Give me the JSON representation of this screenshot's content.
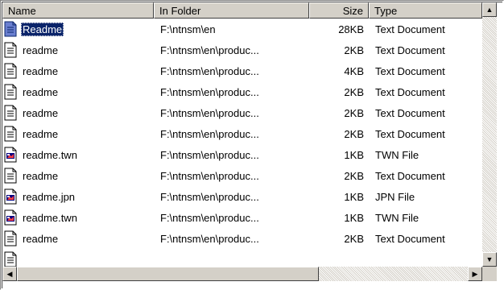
{
  "columns": {
    "name": "Name",
    "folder": "In Folder",
    "size": "Size",
    "type": "Type"
  },
  "rows": [
    {
      "name": "Readme",
      "folder": "F:\\ntnsm\\en",
      "size": "28KB",
      "type": "Text Document",
      "icon": "text-document-icon",
      "selected": true
    },
    {
      "name": "readme",
      "folder": "F:\\ntnsm\\en\\produc...",
      "size": "2KB",
      "type": "Text Document",
      "icon": "text-document-icon"
    },
    {
      "name": "readme",
      "folder": "F:\\ntnsm\\en\\produc...",
      "size": "4KB",
      "type": "Text Document",
      "icon": "text-document-icon"
    },
    {
      "name": "readme",
      "folder": "F:\\ntnsm\\en\\produc...",
      "size": "2KB",
      "type": "Text Document",
      "icon": "text-document-icon"
    },
    {
      "name": "readme",
      "folder": "F:\\ntnsm\\en\\produc...",
      "size": "2KB",
      "type": "Text Document",
      "icon": "text-document-icon"
    },
    {
      "name": "readme",
      "folder": "F:\\ntnsm\\en\\produc...",
      "size": "2KB",
      "type": "Text Document",
      "icon": "text-document-icon"
    },
    {
      "name": "readme.twn",
      "folder": "F:\\ntnsm\\en\\produc...",
      "size": "1KB",
      "type": "TWN File",
      "icon": "generic-file-icon"
    },
    {
      "name": "readme",
      "folder": "F:\\ntnsm\\en\\produc...",
      "size": "2KB",
      "type": "Text Document",
      "icon": "text-document-icon"
    },
    {
      "name": "readme.jpn",
      "folder": "F:\\ntnsm\\en\\produc...",
      "size": "1KB",
      "type": "JPN File",
      "icon": "generic-file-icon"
    },
    {
      "name": "readme.twn",
      "folder": "F:\\ntnsm\\en\\produc...",
      "size": "1KB",
      "type": "TWN File",
      "icon": "generic-file-icon"
    },
    {
      "name": "readme",
      "folder": "F:\\ntnsm\\en\\produc...",
      "size": "2KB",
      "type": "Text Document",
      "icon": "text-document-icon"
    },
    {
      "name": "",
      "folder": "",
      "size": "",
      "type": "",
      "icon": "text-document-icon"
    }
  ],
  "scrollbar": {
    "up_arrow": "▲",
    "down_arrow": "▼",
    "left_arrow": "◀",
    "right_arrow": "▶"
  },
  "colors": {
    "selection": "#0a246a",
    "chrome": "#d4d0c8"
  }
}
